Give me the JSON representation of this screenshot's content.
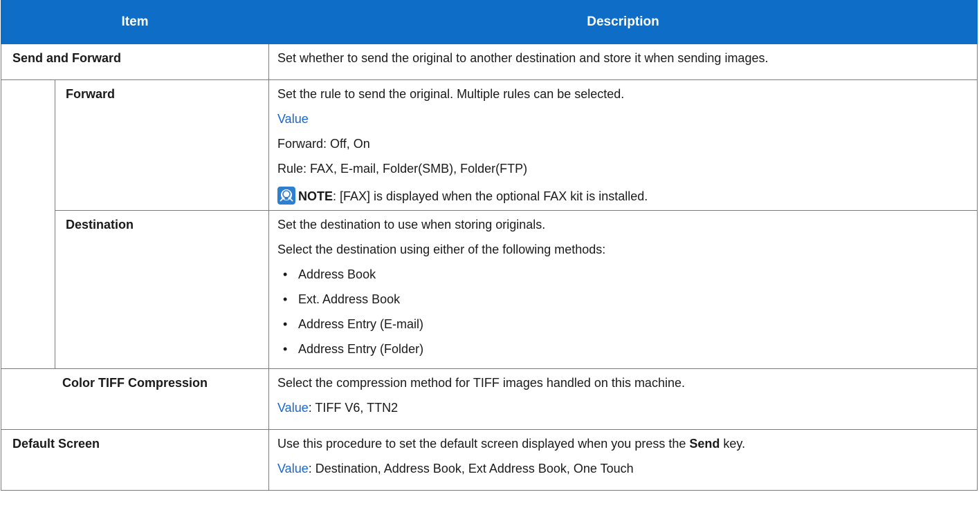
{
  "headers": {
    "item": "Item",
    "description": "Description"
  },
  "rows": {
    "send_forward": {
      "item": "Send and Forward",
      "description": "Set whether to send the original to another destination and store it when sending images."
    },
    "forward": {
      "item": "Forward",
      "line1": "Set the rule to send the original. Multiple rules can be selected.",
      "value_label": "Value",
      "line2": "Forward: Off, On",
      "line3": "Rule: FAX, E-mail, Folder(SMB), Folder(FTP)",
      "note_bold": "NOTE",
      "note_text": ": [FAX] is displayed when the optional FAX kit is installed."
    },
    "destination": {
      "item": "Destination",
      "line1": "Set the destination to use when storing originals.",
      "line2": "Select the destination using either of the following methods:",
      "bullets": [
        "Address Book",
        "Ext. Address Book",
        "Address Entry (E-mail)",
        "Address Entry (Folder)"
      ]
    },
    "tiff": {
      "item": "Color TIFF Compression",
      "line1": "Select the compression method for TIFF images handled on this machine.",
      "value_label": "Value",
      "value_text": ": TIFF V6, TTN2"
    },
    "default_screen": {
      "item": "Default Screen",
      "line1_pre": "Use this procedure to set the default screen displayed when you press the ",
      "line1_bold": "Send",
      "line1_post": " key.",
      "value_label": "Value",
      "value_text": ": Destination, Address Book, Ext Address Book, One Touch"
    }
  },
  "bullet_glyph": "•",
  "colors": {
    "header_bg": "#0d6dc7",
    "value_label": "#1565d8",
    "border": "#7a7a7a"
  },
  "icons": {
    "note": "note-lightbulb-icon"
  }
}
